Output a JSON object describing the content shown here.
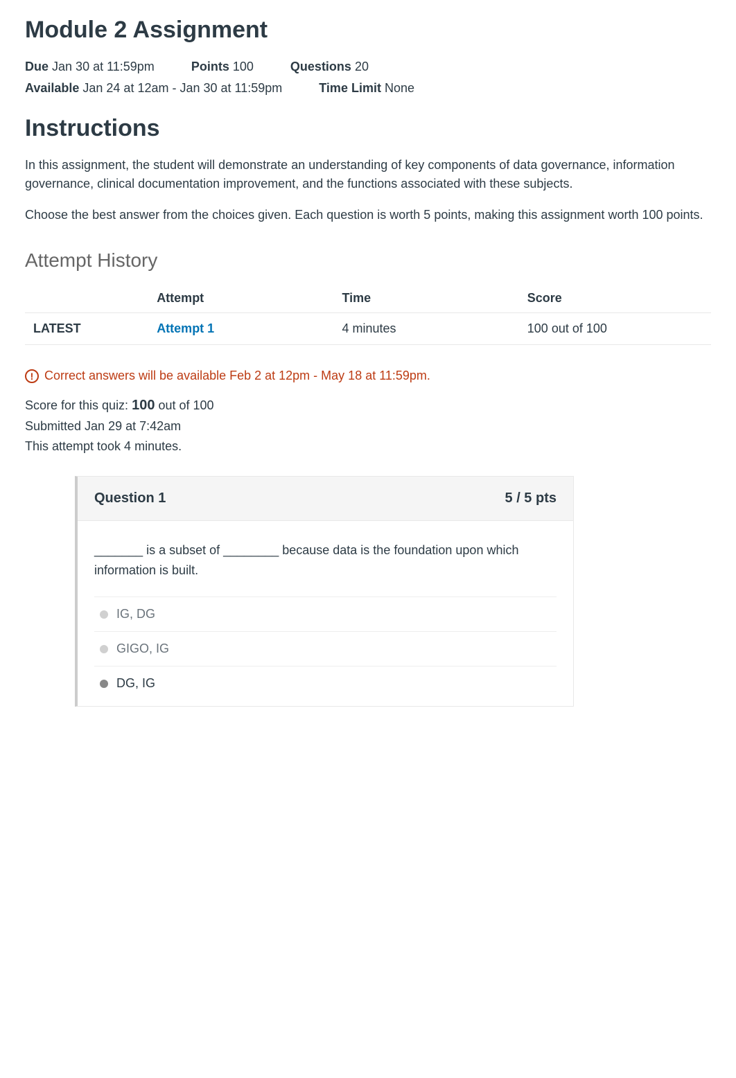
{
  "header": {
    "title": "Module 2 Assignment",
    "meta": {
      "due_label": "Due",
      "due_value": "Jan 30 at 11:59pm",
      "points_label": "Points",
      "points_value": "100",
      "questions_label": "Questions",
      "questions_value": "20",
      "available_label": "Available",
      "available_value": "Jan 24 at 12am - Jan 30 at 11:59pm",
      "timelimit_label": "Time Limit",
      "timelimit_value": "None"
    }
  },
  "instructions": {
    "heading": "Instructions",
    "p1": "In this assignment, the student will demonstrate an understanding of key components of data governance, information governance, clinical documentation improvement, and the functions associated with these subjects.",
    "p2": "Choose the best answer from the choices given. Each question is worth 5 points, making this assignment worth 100 points."
  },
  "history": {
    "heading": "Attempt History",
    "columns": {
      "attempt": "Attempt",
      "time": "Time",
      "score": "Score"
    },
    "rows": [
      {
        "status": "LATEST",
        "attempt": "Attempt 1",
        "time": "4 minutes",
        "score": "100 out of 100"
      }
    ]
  },
  "notice": {
    "icon": "!",
    "text": "Correct answers will be available Feb 2 at 12pm - May 18 at 11:59pm."
  },
  "score": {
    "line1_prefix": "Score for this quiz: ",
    "line1_bold": "100",
    "line1_suffix": " out of 100",
    "line2": "Submitted Jan 29 at 7:42am",
    "line3": "This attempt took 4 minutes."
  },
  "question1": {
    "title": "Question 1",
    "pts": "5 / 5 pts",
    "stem": "_______ is a subset of ________ because data is the foundation upon which information is built.",
    "answers": [
      {
        "text": "IG, DG",
        "selected": false,
        "dark": false
      },
      {
        "text": "GIGO, IG",
        "selected": false,
        "dark": false
      },
      {
        "text": "DG, IG",
        "selected": true,
        "dark": true
      }
    ]
  }
}
